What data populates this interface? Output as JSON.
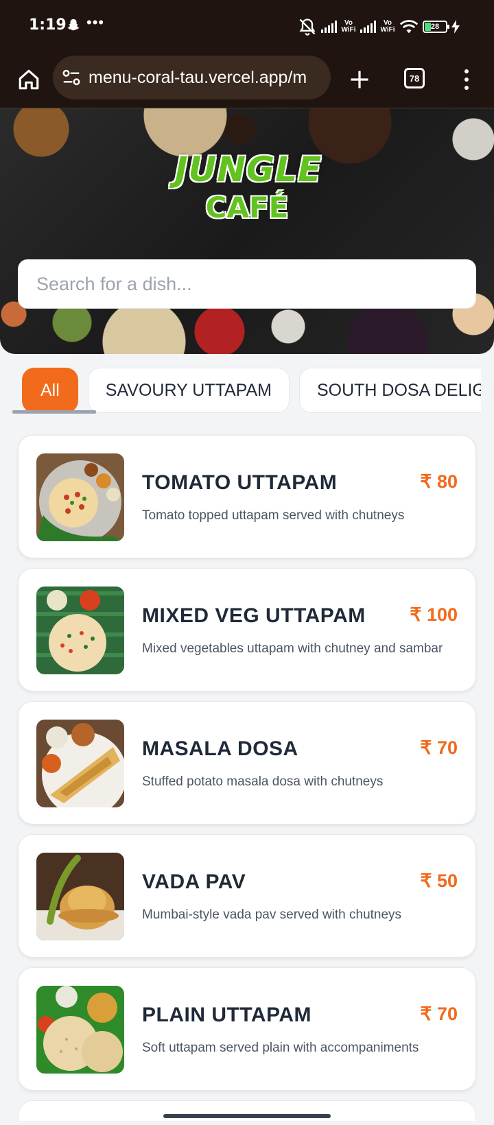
{
  "status_bar": {
    "time": "1:19",
    "battery": "28",
    "vowifi_label": "Vo WiFi",
    "icons": [
      "snapchat-icon",
      "more-notifications-icon",
      "mute-icon",
      "signal-icon",
      "vowifi-icon",
      "signal-icon",
      "vowifi-icon",
      "wifi-icon",
      "battery-icon",
      "charging-icon"
    ]
  },
  "browser": {
    "url": "menu-coral-tau.vercel.app/m",
    "tab_count": "78"
  },
  "hero": {
    "logo_line1": "JUNGLE",
    "logo_line2": "CAFÉ",
    "search_placeholder": "Search for a dish..."
  },
  "categories": [
    "All",
    "SAVOURY UTTAPAM",
    "SOUTH DOSA DELIGHTS"
  ],
  "items": [
    {
      "name": "TOMATO UTTAPAM",
      "price": "₹ 80",
      "description": "Tomato topped uttapam served with chutneys"
    },
    {
      "name": "MIXED VEG UTTAPAM",
      "price": "₹ 100",
      "description": "Mixed vegetables uttapam with chutney and sambar"
    },
    {
      "name": "MASALA DOSA",
      "price": "₹ 70",
      "description": "Stuffed potato masala dosa with chutneys"
    },
    {
      "name": "VADA PAV",
      "price": "₹ 50",
      "description": "Mumbai-style vada pav served with chutneys"
    },
    {
      "name": "PLAIN UTTAPAM",
      "price": "₹ 70",
      "description": "Soft uttapam served plain with accompaniments"
    }
  ],
  "colors": {
    "accent": "#f26a1b",
    "brand_green": "#62c21f",
    "chrome": "#1f1410"
  }
}
